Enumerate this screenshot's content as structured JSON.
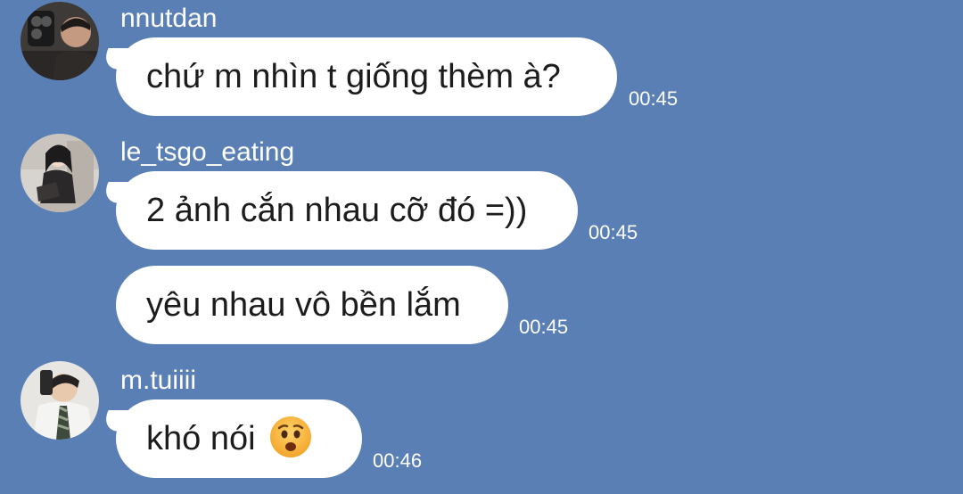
{
  "messages": [
    {
      "sender": "nnutdan",
      "text": "chứ m nhìn t giống thèm à?",
      "time": "00:45"
    },
    {
      "sender": "le_tsgo_eating",
      "text": "2 ảnh cắn nhau cỡ đó =))",
      "time": "00:45"
    },
    {
      "sender": "",
      "text": "yêu nhau vô bền lắm",
      "time": "00:45"
    },
    {
      "sender": "m.tuiiii",
      "text": "khó nói",
      "emoji": "anxious-face-emoji",
      "time": "00:46"
    }
  ],
  "colors": {
    "background": "#5a7fb4",
    "bubble": "#ffffff",
    "bubble_text": "#1c1c1c",
    "meta_text": "#ffffff"
  }
}
